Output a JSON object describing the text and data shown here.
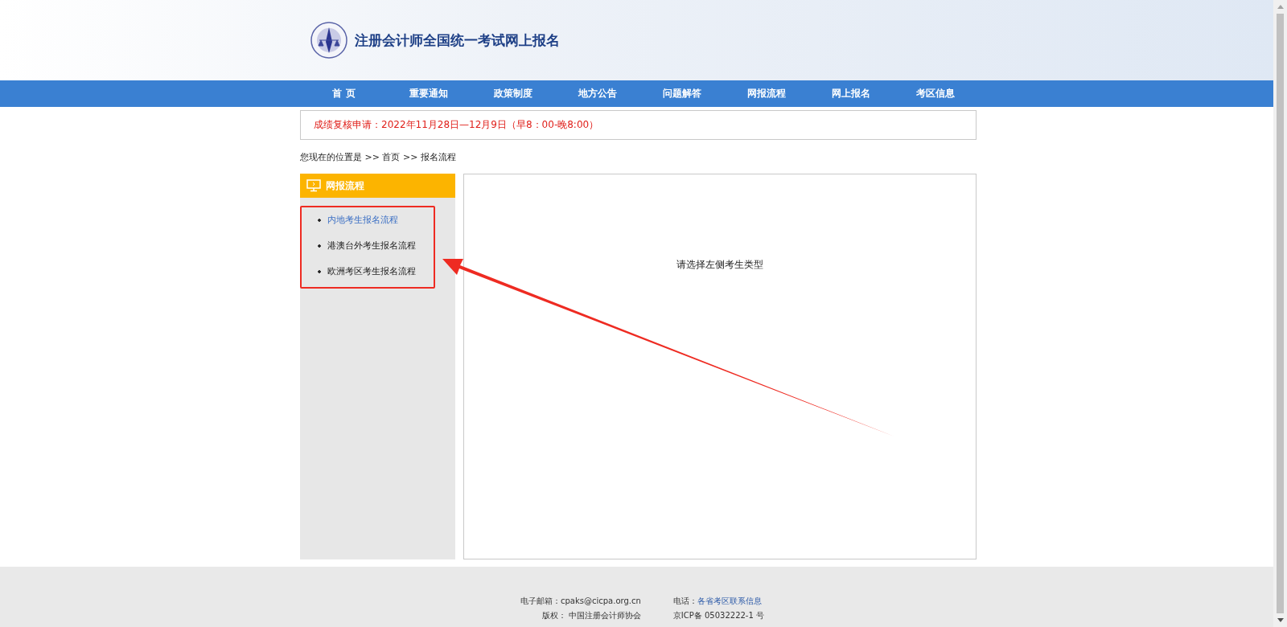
{
  "header": {
    "title": "注册会计师全国统一考试网上报名"
  },
  "nav": [
    {
      "label": "首 页"
    },
    {
      "label": "重要通知"
    },
    {
      "label": "政策制度"
    },
    {
      "label": "地方公告"
    },
    {
      "label": "问题解答"
    },
    {
      "label": "网报流程"
    },
    {
      "label": "网上报名"
    },
    {
      "label": "考区信息"
    }
  ],
  "notice": "成绩复核申请：2022年11月28日—12月9日（早8：00-晚8:00）",
  "breadcrumb": "您现在的位置是 >> 首页 >> 报名流程",
  "sidebar": {
    "title": "网报流程",
    "items": [
      {
        "label": "内地考生报名流程",
        "selected": true
      },
      {
        "label": "港澳台外考生报名流程",
        "selected": false
      },
      {
        "label": "欧洲考区考生报名流程",
        "selected": false
      }
    ]
  },
  "main": {
    "message": "请选择左侧考生类型"
  },
  "footer": {
    "rows": [
      [
        {
          "kind": "text",
          "text": "电子邮箱：cpaks@cicpa.org.cn"
        },
        {
          "kind": "labeled-link",
          "label": "电话：",
          "link": "各省考区联系信息"
        }
      ],
      [
        {
          "kind": "text",
          "text": "版权： 中国注册会计师协会"
        },
        {
          "kind": "text",
          "text": "京ICP备 05032222-1 号"
        }
      ]
    ]
  }
}
